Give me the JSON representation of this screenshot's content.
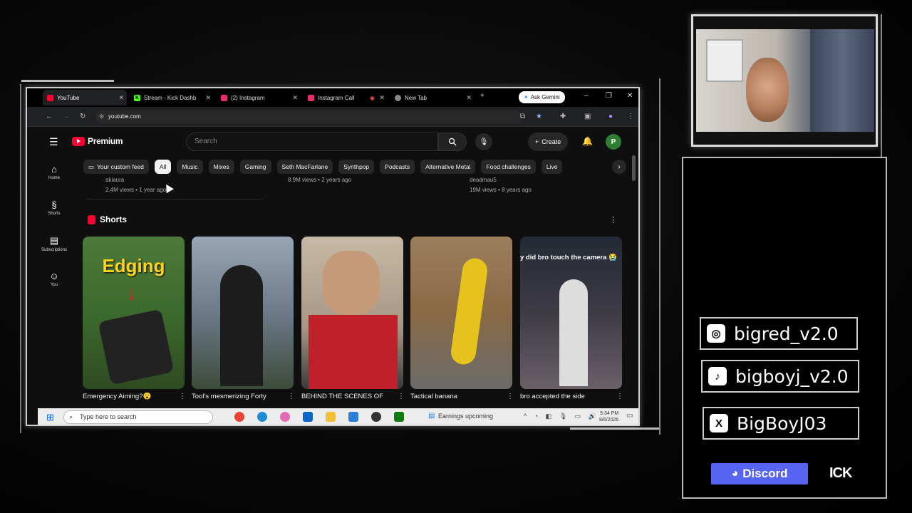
{
  "browser": {
    "tabs": [
      {
        "label": "YouTube",
        "active": true,
        "icon": "youtube-icon",
        "color": "#ff0033"
      },
      {
        "label": "Stream - Kick Dashb",
        "active": false,
        "icon": "kick-icon",
        "color": "#53fc18"
      },
      {
        "label": "(2) Instagram",
        "active": false,
        "icon": "instagram-icon",
        "color": "#e1306c"
      },
      {
        "label": "Instagram Call",
        "active": false,
        "icon": "instagram-icon",
        "color": "#e1306c"
      },
      {
        "label": "New Tab",
        "active": false,
        "icon": "chrome-icon",
        "color": "#888888"
      }
    ],
    "gemini_label": "Ask Gemini",
    "url": "youtube.com"
  },
  "youtube": {
    "logo_text": "Premium",
    "search_placeholder": "Search",
    "create_label": "Create",
    "avatar_letter": "P",
    "chips": [
      "Your custom feed",
      "All",
      "Music",
      "Mixes",
      "Gaming",
      "Seth MacFarlane",
      "Synthpop",
      "Podcasts",
      "Alternative Metal",
      "Food challenges",
      "Live"
    ],
    "sidebar": [
      {
        "label": "Home",
        "icon": "home-icon"
      },
      {
        "label": "Shorts",
        "icon": "shorts-icon"
      },
      {
        "label": "Subscriptions",
        "icon": "subscriptions-icon"
      },
      {
        "label": "You",
        "icon": "you-icon"
      }
    ],
    "prev_row": {
      "v1_channel": "akiaura",
      "v1_meta": "2.4M views • 1 year ago",
      "v2_meta": "8.9M views • 2 years ago",
      "v3_channel": "deadmau5",
      "v3_meta": "19M views • 8 years ago"
    },
    "shorts_heading": "Shorts",
    "shorts": [
      {
        "title": "Emergency Aiming?😮",
        "overlay": "Edging"
      },
      {
        "title": "Tool's mesmerizing Forty",
        "overlay": ""
      },
      {
        "title": "BEHIND THE SCENES OF",
        "overlay": ""
      },
      {
        "title": "Tactical banana",
        "overlay": ""
      },
      {
        "title": "bro accepted the side",
        "overlay": "y did bro touch the camera 😭"
      }
    ]
  },
  "taskbar": {
    "search_placeholder": "Type here to search",
    "news": "Earnings upcoming",
    "time": "5:34 PM",
    "date": "8/6/2026"
  },
  "socials": [
    {
      "handle": "bigred_v2.0",
      "icon": "instagram-icon"
    },
    {
      "handle": "bigboyj_v2.0",
      "icon": "tiktok-icon"
    },
    {
      "handle": "BigBoyJ03",
      "icon": "x-icon"
    }
  ],
  "discord_label": "Discord",
  "kick_label": "ICK"
}
